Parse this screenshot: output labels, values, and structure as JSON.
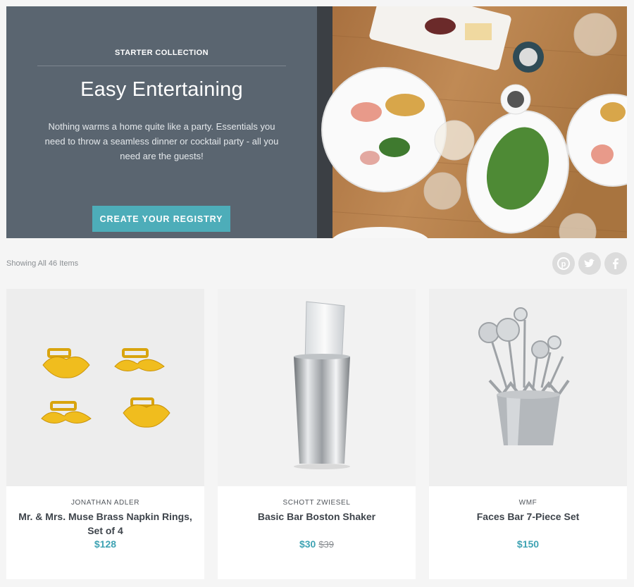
{
  "hero": {
    "eyebrow": "STARTER COLLECTION",
    "title": "Easy Entertaining",
    "description": "Nothing warms a home quite like a party. Essentials you need to throw a seamless dinner or cocktail party - all you need are the guests!",
    "cta_label": "CREATE YOUR REGISTRY",
    "colors": {
      "panel": "#5a6570",
      "cta": "#4dadb9"
    }
  },
  "toolbar": {
    "count_text": "Showing All 46 Items",
    "social": [
      {
        "icon": "pinterest-icon"
      },
      {
        "icon": "twitter-icon"
      },
      {
        "icon": "facebook-icon"
      }
    ]
  },
  "products": [
    {
      "brand": "JONATHAN ADLER",
      "name": "Mr. & Mrs. Muse Brass Napkin Rings, Set of 4",
      "price": "$128",
      "old_price": ""
    },
    {
      "brand": "SCHOTT ZWIESEL",
      "name": "Basic Bar Boston Shaker",
      "price": "$30",
      "old_price": "$39"
    },
    {
      "brand": "WMF",
      "name": "Faces Bar 7-Piece Set",
      "price": "$150",
      "old_price": ""
    }
  ],
  "accent_color": "#3fa3b3"
}
